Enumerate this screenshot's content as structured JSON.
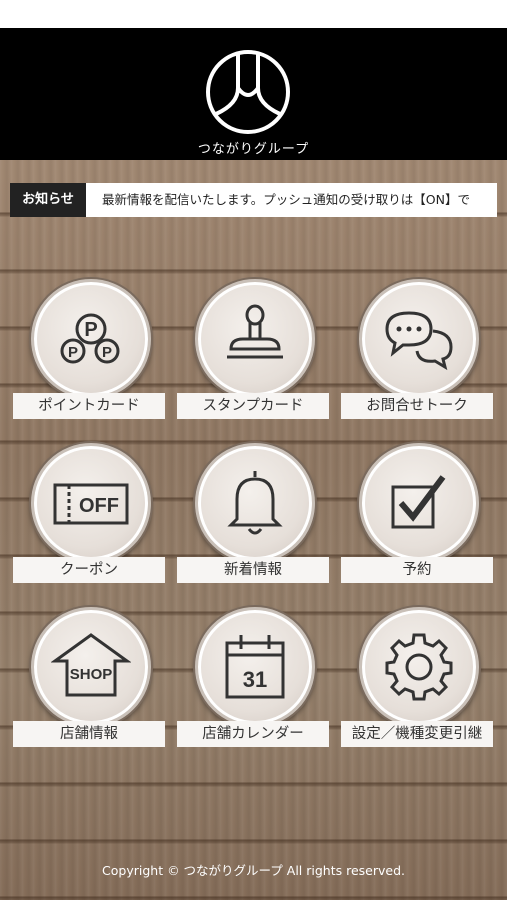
{
  "header": {
    "brand": "つながりグループ"
  },
  "news": {
    "tag": "お知らせ",
    "text": "最新情報を配信いたします。プッシュ通知の受け取りは【ON】で"
  },
  "menu": [
    {
      "label": "ポイントカード",
      "icon": "point-card-icon"
    },
    {
      "label": "スタンプカード",
      "icon": "stamp-icon"
    },
    {
      "label": "お問合せトーク",
      "icon": "chat-bubbles-icon"
    },
    {
      "label": "クーポン",
      "icon": "coupon-icon",
      "coupon_text": "OFF"
    },
    {
      "label": "新着情報",
      "icon": "bell-icon"
    },
    {
      "label": "予約",
      "icon": "checkbox-icon"
    },
    {
      "label": "店舗情報",
      "icon": "shop-icon",
      "shop_text": "SHOP"
    },
    {
      "label": "店舗カレンダー",
      "icon": "calendar-icon",
      "calendar_text": "31"
    },
    {
      "label": "設定／機種変更引継",
      "icon": "gear-icon"
    }
  ],
  "footer": {
    "copyright": "Copyright © つながりグループ All rights reserved."
  }
}
